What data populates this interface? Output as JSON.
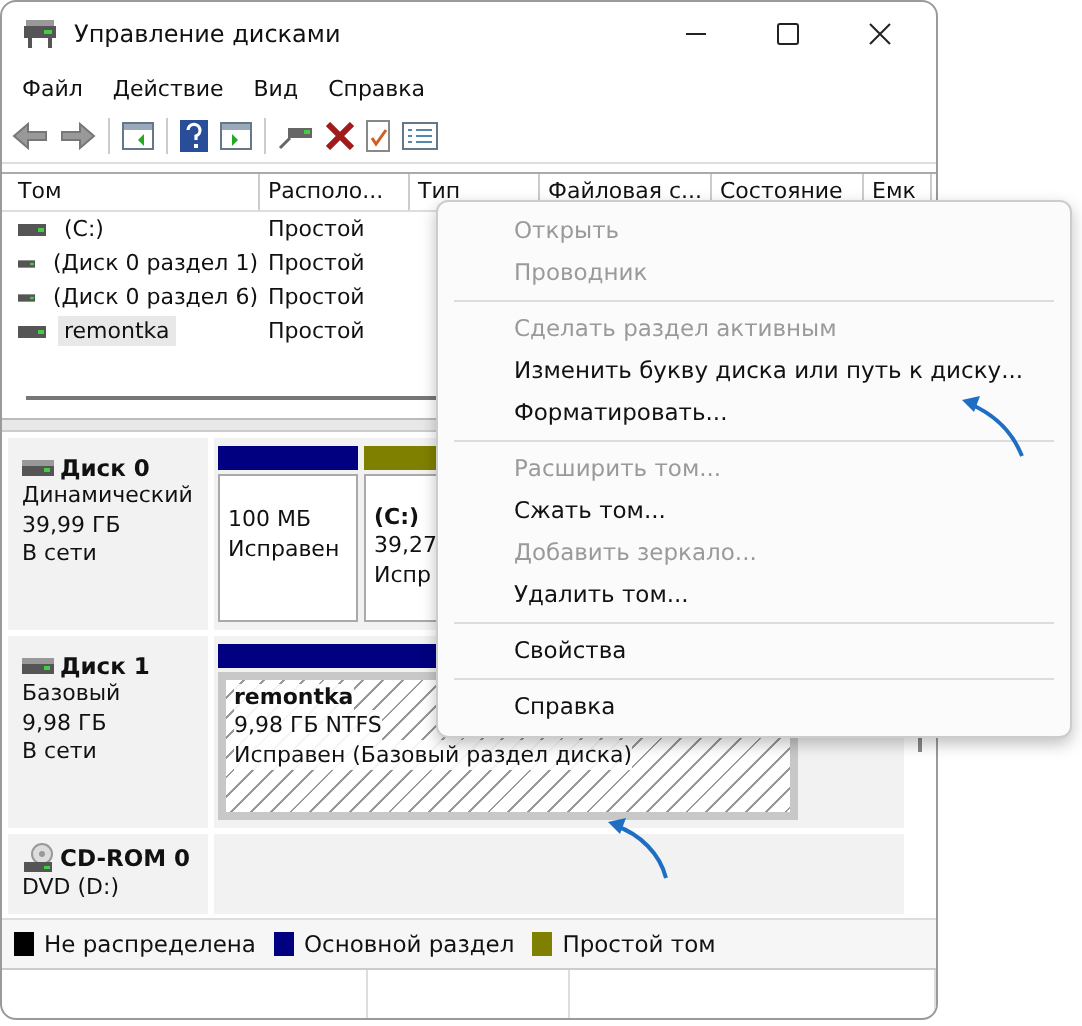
{
  "window": {
    "title": "Управление дисками"
  },
  "menu_bar": [
    "Файл",
    "Действие",
    "Вид",
    "Справка"
  ],
  "volume_table": {
    "columns": [
      "Том",
      "Располо...",
      "Тип",
      "Файловая с...",
      "Состояние",
      "Емк"
    ],
    "rows": [
      {
        "cells": [
          "(C:)",
          "Простой"
        ],
        "selected": false
      },
      {
        "cells": [
          "(Диск 0 раздел 1)",
          "Простой"
        ],
        "selected": false
      },
      {
        "cells": [
          "(Диск 0 раздел 6)",
          "Простой"
        ],
        "selected": false
      },
      {
        "cells": [
          "remontka",
          "Простой"
        ],
        "selected": true
      }
    ]
  },
  "disks": [
    {
      "kind": "hdd",
      "name": "Диск 0",
      "type": "Динамический",
      "size": "39,99 ГБ",
      "status": "В сети",
      "partitions": [
        {
          "color": "#000080",
          "lines": [
            "100 МБ",
            "Исправен"
          ],
          "selected": false
        },
        {
          "color": "#808000",
          "title": "(C:)",
          "lines": [
            "39,27",
            "Испр"
          ],
          "selected": false
        }
      ]
    },
    {
      "kind": "hdd",
      "name": "Диск 1",
      "type": "Базовый",
      "size": "9,98 ГБ",
      "status": "В сети",
      "partitions": [
        {
          "color": "#000080",
          "title": "remontka",
          "lines": [
            "9,98 ГБ NTFS",
            "Исправен (Базовый раздел диска)"
          ],
          "selected": true
        }
      ]
    },
    {
      "kind": "cdrom",
      "name": "CD-ROM 0",
      "type": "DVD (D:)"
    }
  ],
  "legend": [
    {
      "label": "Не распределена",
      "color": "#000000"
    },
    {
      "label": "Основной раздел",
      "color": "#000080"
    },
    {
      "label": "Простой том",
      "color": "#808000"
    }
  ],
  "context_menu": {
    "items": [
      {
        "kind": "item",
        "label": "Открыть",
        "disabled": true
      },
      {
        "kind": "item",
        "label": "Проводник",
        "disabled": true
      },
      {
        "kind": "separator"
      },
      {
        "kind": "item",
        "label": "Сделать раздел активным",
        "disabled": true
      },
      {
        "kind": "item",
        "label": "Изменить букву диска или путь к диску...",
        "disabled": false
      },
      {
        "kind": "item",
        "label": "Форматировать...",
        "disabled": false
      },
      {
        "kind": "separator"
      },
      {
        "kind": "item",
        "label": "Расширить том...",
        "disabled": true
      },
      {
        "kind": "item",
        "label": "Сжать том...",
        "disabled": false
      },
      {
        "kind": "item",
        "label": "Добавить зеркало...",
        "disabled": true
      },
      {
        "kind": "item",
        "label": "Удалить том...",
        "disabled": false
      },
      {
        "kind": "separator"
      },
      {
        "kind": "item",
        "label": "Свойства",
        "disabled": false
      },
      {
        "kind": "separator"
      },
      {
        "kind": "item",
        "label": "Справка",
        "disabled": false
      }
    ]
  }
}
